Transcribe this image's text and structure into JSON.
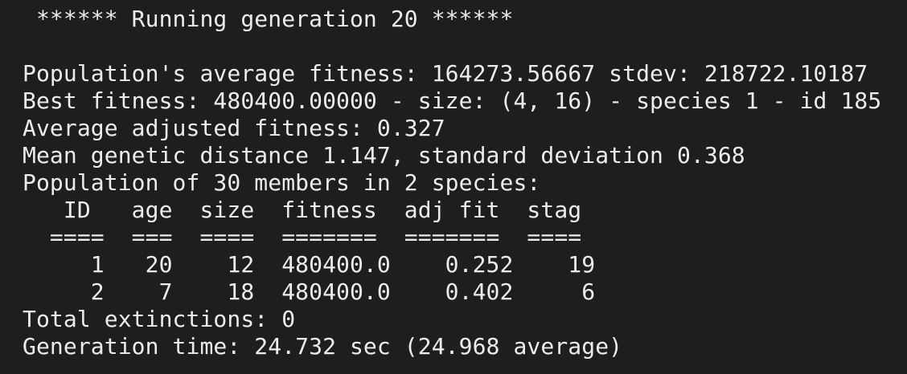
{
  "terminal": {
    "header": " ****** Running generation 20 ****** ",
    "lines": [
      "Population's average fitness: 164273.56667 stdev: 218722.10187",
      "Best fitness: 480400.00000 - size: (4, 16) - species 1 - id 185",
      "Average adjusted fitness: 0.327",
      "Mean genetic distance 1.147, standard deviation 0.368",
      "Population of 30 members in 2 species:"
    ],
    "table": {
      "header": "   ID   age  size  fitness  adj fit  stag",
      "rule": "  ====  ===  ====  =======  =======  ====",
      "rows": [
        "     1   20    12  480400.0    0.252    19",
        "     2    7    18  480400.0    0.402     6"
      ]
    },
    "footer": [
      "Total extinctions: 0",
      "Generation time: 24.732 sec (24.968 average)"
    ]
  }
}
